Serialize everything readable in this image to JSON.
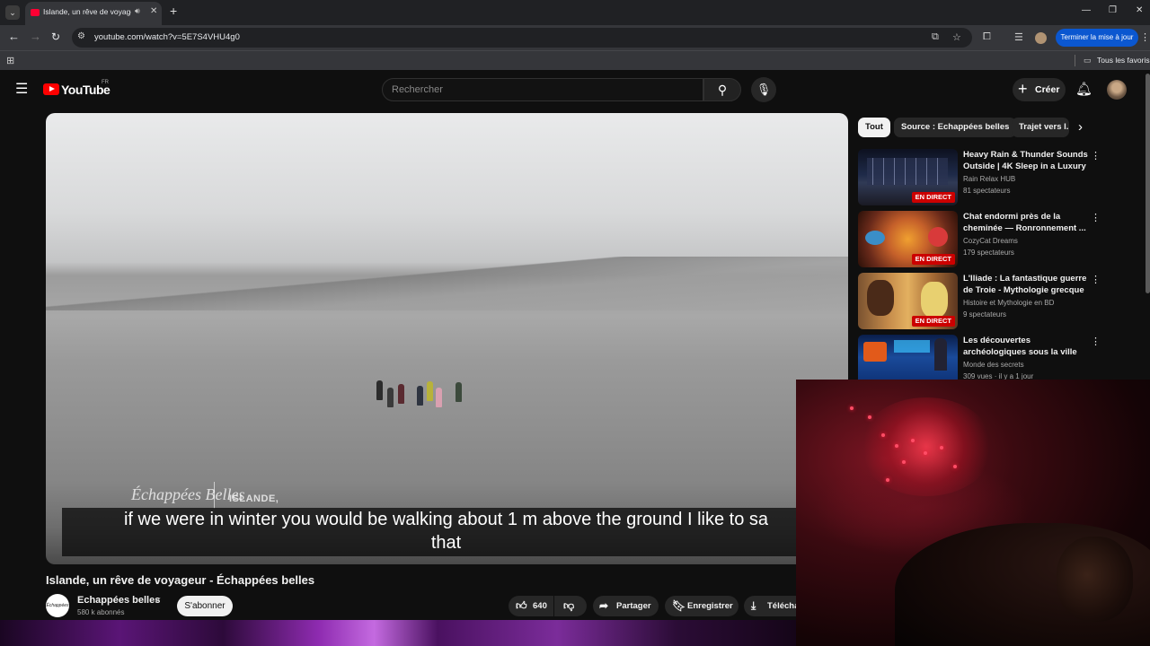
{
  "browser": {
    "tab_title": "Islande, un rêve de voyageur - Échappées belles",
    "sound_icon": "speaker-icon",
    "url": "youtube.com/watch?v=5E7S4VHU4g0",
    "update_button": "Terminer la mise à jour",
    "bookmarks_all": "Tous les favoris"
  },
  "youtube": {
    "logo_text": "YouTube",
    "region": "FR",
    "search_placeholder": "Rechercher",
    "create_label": "Créer"
  },
  "player": {
    "brand": "Échappées Belles",
    "place": "ISLANDE,",
    "caption_line1": "if we were in winter you would be walking about 1 m above the ground I like to sa",
    "caption_line2": "that"
  },
  "video": {
    "title": "Islande, un rêve de voyageur - Échappées belles",
    "channel": "Echappées belles",
    "channel_avatar_text": "Échappées belles",
    "subscribers": "580 k abonnés",
    "subscribe_label": "S'abonner",
    "likes": "640",
    "share_label": "Partager",
    "save_label": "Enregistrer",
    "download_label": "Téléchar"
  },
  "chips": [
    "Tout",
    "Source : Echappées belles",
    "Trajet vers l..."
  ],
  "recommendations": [
    {
      "title": "Heavy Rain & Thunder Sounds Outside | 4K Sleep in a Luxury ...",
      "channel": "Rain Relax HUB",
      "meta": "81 spectateurs",
      "live": "EN DIRECT"
    },
    {
      "title": "Chat endormi près de la cheminée — Ronronnement ...",
      "channel": "CozyCat Dreams",
      "meta": "179 spectateurs",
      "live": "EN DIRECT"
    },
    {
      "title": "L'Iliade : La fantastique guerre de Troie - Mythologie grecque",
      "channel": "Histoire et Mythologie en BD",
      "meta": "9 spectateurs",
      "live": "EN DIRECT"
    },
    {
      "title": "Les découvertes archéologiques sous la ville de...",
      "channel": "Monde des secrets",
      "meta": "309 vues · il y a 1 jour",
      "live": ""
    }
  ],
  "colors": {
    "accent": "#ff0000",
    "live_badge": "#cc0000",
    "update_button": "#0b57d0"
  }
}
